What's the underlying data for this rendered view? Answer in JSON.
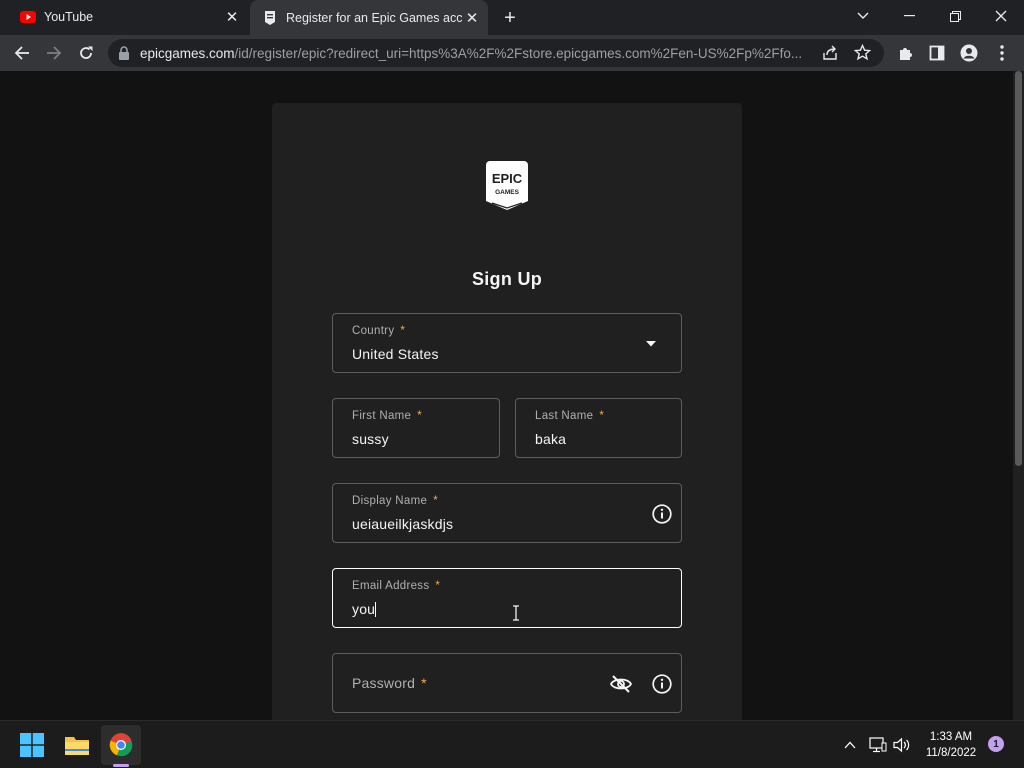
{
  "browser": {
    "tabs": [
      {
        "title": "YouTube",
        "icon": "youtube-icon",
        "active": false
      },
      {
        "title": "Register for an Epic Games account",
        "icon": "epic-games-icon",
        "active": true
      }
    ],
    "url_host": "epicgames.com",
    "url_path": "/id/register/epic?redirect_uri=https%3A%2F%2Fstore.epicgames.com%2Fen-US%2Fp%2Ffo..."
  },
  "form": {
    "logo_text_line1": "EPIC",
    "logo_text_line2": "GAMES",
    "heading": "Sign Up",
    "required_marker": "*",
    "country": {
      "label": "Country",
      "value": "United States"
    },
    "first_name": {
      "label": "First Name",
      "value": "sussy"
    },
    "last_name": {
      "label": "Last Name",
      "value": "baka"
    },
    "display_name": {
      "label": "Display Name",
      "value": "ueiaueilkjaskdjs"
    },
    "email": {
      "label": "Email Address",
      "value": "you"
    },
    "password": {
      "label": "Password",
      "value": ""
    }
  },
  "taskbar": {
    "apps": [
      "start-icon",
      "file-explorer-icon",
      "chrome-icon"
    ],
    "time": "1:33 AM",
    "date": "11/8/2022",
    "notification_count": "1"
  },
  "colors": {
    "page_bg": "#121212",
    "card_bg": "#202020",
    "required_accent": "#f0ad4e",
    "field_border": "#5d5d5d",
    "focused_border": "#ffffff"
  }
}
